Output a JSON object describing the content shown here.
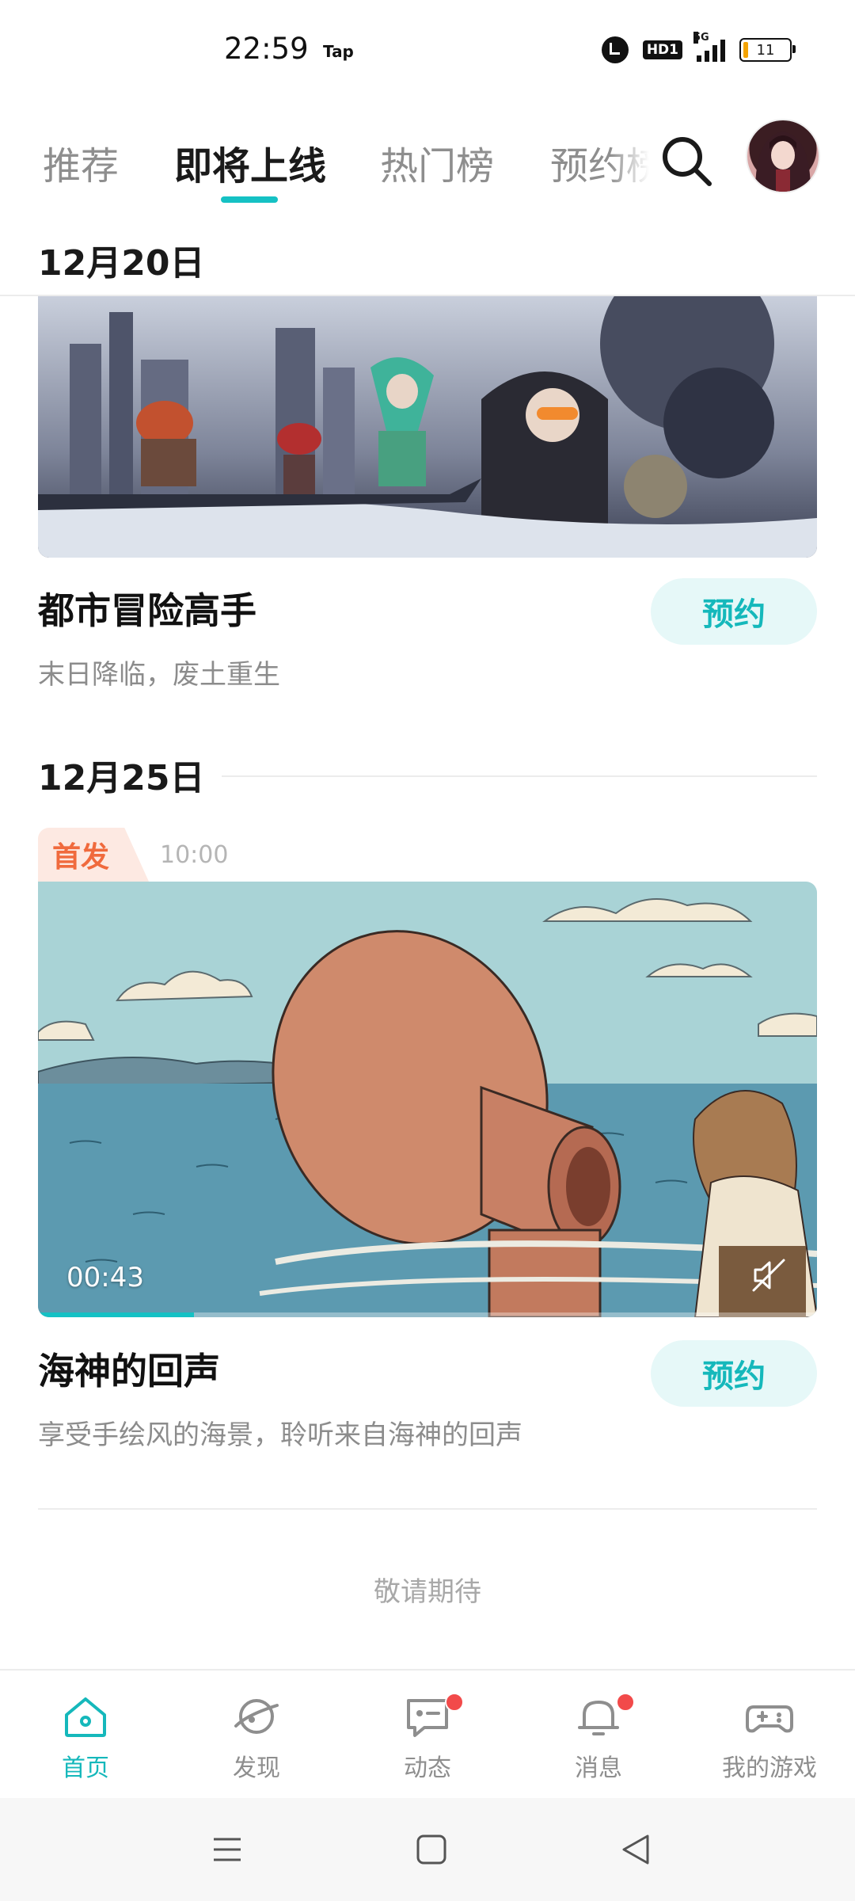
{
  "status_bar": {
    "time": "22:59",
    "app_indicator": "Tap",
    "hd_label": "HD1",
    "network": "5G",
    "battery": "11"
  },
  "top_tabs": [
    {
      "label": "推荐",
      "active": false
    },
    {
      "label": "即将上线",
      "active": true
    },
    {
      "label": "热门榜",
      "active": false
    },
    {
      "label": "预约榜",
      "active": false
    }
  ],
  "icons": {
    "search": "search-icon",
    "avatar": "avatar"
  },
  "sections": [
    {
      "date": "12月20日",
      "game": {
        "title": "都市冒险高手",
        "description": "末日降临，废土重生",
        "button": "预约"
      }
    },
    {
      "date": "12月25日",
      "game": {
        "tag": "首发",
        "release_time": "10:00",
        "video_duration": "00:43",
        "video_progress": 0.2,
        "title": "海神的回声",
        "description": "享受手绘风的海景，聆听来自海神的回声",
        "button": "预约"
      }
    }
  ],
  "end_text": "敬请期待",
  "bottom_nav": [
    {
      "label": "首页",
      "icon": "home-icon",
      "active": true,
      "badge": false
    },
    {
      "label": "发现",
      "icon": "planet-icon",
      "active": false,
      "badge": false
    },
    {
      "label": "动态",
      "icon": "chat-icon",
      "active": false,
      "badge": true
    },
    {
      "label": "消息",
      "icon": "bell-icon",
      "active": false,
      "badge": true
    },
    {
      "label": "我的游戏",
      "icon": "gamepad-icon",
      "active": false,
      "badge": false
    }
  ],
  "colors": {
    "accent": "#15c1c4",
    "tag_text": "#f06a3d",
    "badge": "#f24a4a"
  }
}
